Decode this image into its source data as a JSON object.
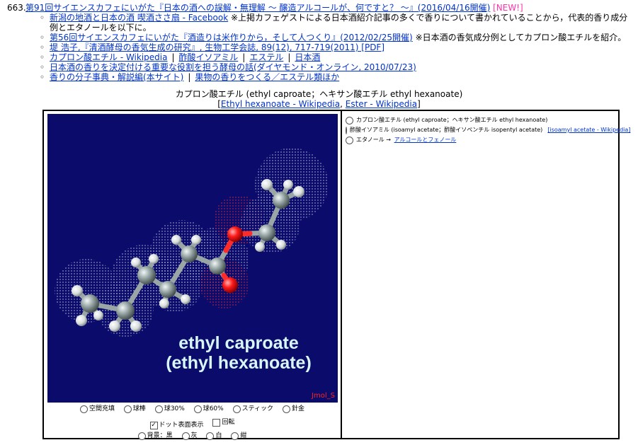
{
  "entry": {
    "number": "663.",
    "title_link": "第91回サイエンスカフェにいがた『日本の酒への誤解・無理解 ～ 醸造アルコールが、何ですと？ ～』(2016/04/16開催)",
    "new_badge": "[NEW!]",
    "subs": [
      {
        "link": "新潟の地酒と日本の酒 喫酒ささ扇 - Facebook",
        "note": "※上掲カフェゲストによる日本酒紹介記事の多くで香りについて書かれていることから，代表的香り成分例とエタノールを以下に。"
      },
      {
        "link": "第56回サイエンスカフェにいがた『酒造りは米作りから，そして人つくり』(2012/02/25開催)",
        "note": "※日本酒の香気成分例としてカプロン酸エチルを紹介。"
      },
      {
        "link": "堤 浩子,『清酒酵母の香気生成の研究』, 生物工学会誌, 89(12), 717-719(2011) [PDF]",
        "note": ""
      },
      {
        "links": [
          "カプロン酸エチル - Wikipedia",
          "酢酸イソアミル",
          "エステル",
          "日本酒"
        ]
      },
      {
        "link": "日本酒の香りを決定付ける重要な役割を担う酵母の話(ダイヤモンド・オンライン, 2010/07/23)",
        "note": ""
      },
      {
        "links": [
          "香りの分子事典・解説編(本サイト)",
          "果物の香りをつくる／エステル類ほか"
        ]
      }
    ]
  },
  "molecule": {
    "title": "カプロン酸エチル (ethyl caproate；ヘキサン酸エチル ethyl hexanoate)",
    "links": [
      "Ethyl hexanoate - Wikipedia",
      "Ester - Wikipedia"
    ],
    "render_label_line1": "ethyl caproate",
    "render_label_line2": "(ethyl hexanoate)",
    "watermark": "Jmol_S"
  },
  "controls": {
    "row1": [
      "空間充填",
      "球棒",
      "球30%",
      "球60%",
      "スティック",
      "針金"
    ],
    "dot_surface": "ドット表面表示",
    "rotate": "回転",
    "bg_label": "背景：黒",
    "bg_options": [
      "灰",
      "白",
      "紺"
    ]
  },
  "sidebar": {
    "item1": "カプロン酸エチル (ethyl caproate；ヘキサン酸エチル ethyl hexanoate)",
    "item2": "酢酸イソアミル (isoamyl acetate；酢酸イソペンチル isopentyl acetate)",
    "item2_link": "[isoamyl acetate - Wikipedia]",
    "item3": "エタノール →",
    "item3_link": "アルコールとフェノール"
  },
  "colors": {
    "viewer_bg": "#0b0b6b",
    "carbon": "#8a9a9a",
    "hydrogen": "#ffffff",
    "oxygen": "#ff1a1a",
    "link": "#0033cc",
    "new": "#ff33aa"
  }
}
